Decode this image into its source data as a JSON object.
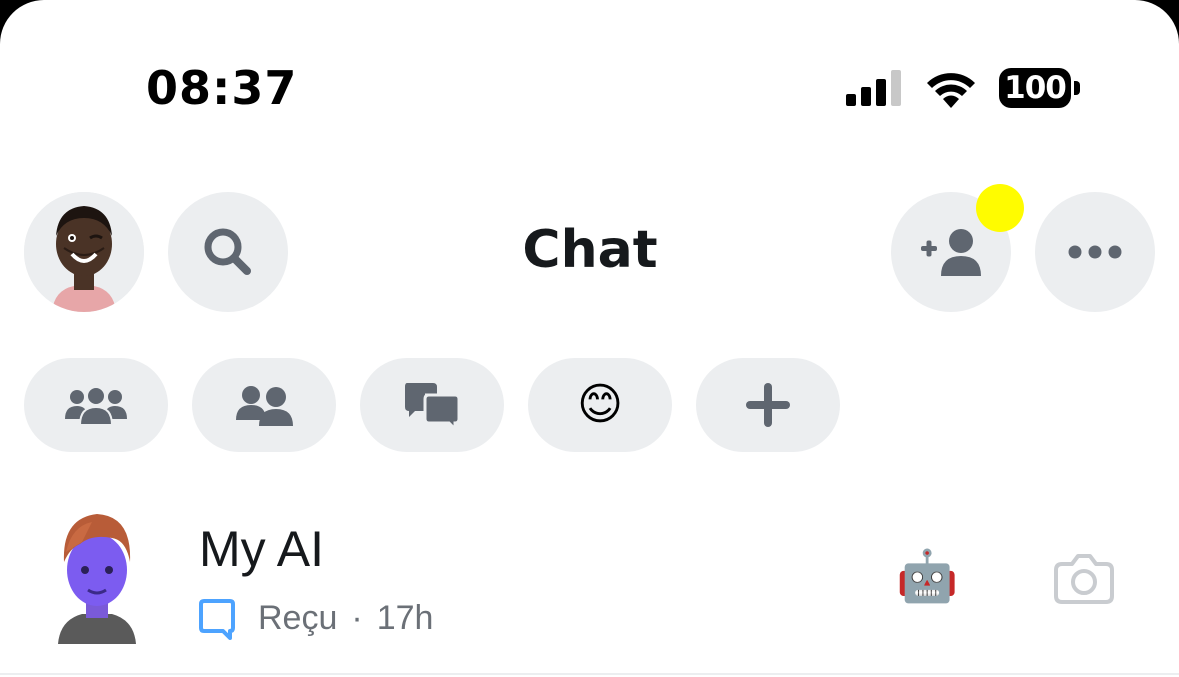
{
  "status_bar": {
    "time": "08:37",
    "battery": "100",
    "icons": [
      "signal-icon",
      "wifi-icon",
      "battery-icon"
    ]
  },
  "header": {
    "title": "Chat",
    "left_buttons": [
      "profile-avatar",
      "search-icon"
    ],
    "right_buttons": [
      "add-friend-icon",
      "more-icon"
    ],
    "notification_dot_color": "#fffc00"
  },
  "filters": {
    "items": [
      "groups-icon",
      "friends-icon",
      "chats-icon",
      "smiley-icon",
      "plus-icon"
    ],
    "smiley": "😊"
  },
  "chats": [
    {
      "name": "My AI",
      "status": "Reçu",
      "separator": "·",
      "time": "17h",
      "badge": "🤖",
      "status_icon": "chat-bubble-icon",
      "status_color": "#4da3ff"
    }
  ],
  "colors": {
    "background": "#ffffff",
    "button_bg": "#eceef0",
    "icon_gray": "#5f6670",
    "text_primary": "#16191c",
    "text_secondary": "#6b7077"
  }
}
